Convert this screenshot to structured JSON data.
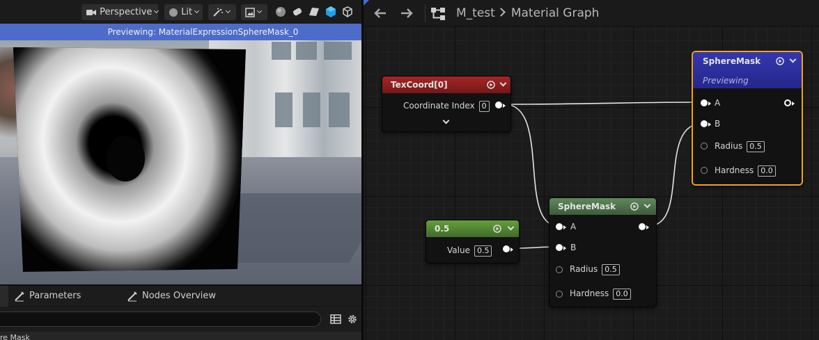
{
  "viewport": {
    "toolbar": {
      "view_mode": "Perspective",
      "lighting": "Lit"
    },
    "preview_banner": "Previewing: MaterialExpressionSphereMask_0",
    "tabs": [
      {
        "label": "Parameters"
      },
      {
        "label": "Nodes Overview"
      }
    ],
    "details_partial": "re Mask"
  },
  "graph": {
    "breadcrumb": {
      "asset": "M_test",
      "graph": "Material Graph"
    },
    "nodes": {
      "texcoord": {
        "title": "TexCoord[0]",
        "pin_label": "Coordinate Index",
        "pin_value": "0",
        "header_color": "#8c1f1f"
      },
      "constant": {
        "title": "0.5",
        "pin_label": "Value",
        "pin_value": "0.5",
        "header_color": "#4a7a2e"
      },
      "spheremask_inner": {
        "title": "SphereMask",
        "pins": {
          "a": "A",
          "b": "B",
          "radius_label": "Radius",
          "radius_value": "0.5",
          "hardness_label": "Hardness",
          "hardness_value": "0.0"
        },
        "header_color": "#4c6b4a"
      },
      "spheremask_preview": {
        "title": "SphereMask",
        "subtitle": "Previewing",
        "pins": {
          "a": "A",
          "b": "B",
          "radius_label": "Radius",
          "radius_value": "0.5",
          "hardness_label": "Hardness",
          "hardness_value": "0.0"
        },
        "header_color": "#2a2f9a",
        "border_color": "#f0a21c"
      }
    }
  },
  "colors": {
    "accent": "#4d6cc9",
    "wire": "#e6e6e6"
  }
}
